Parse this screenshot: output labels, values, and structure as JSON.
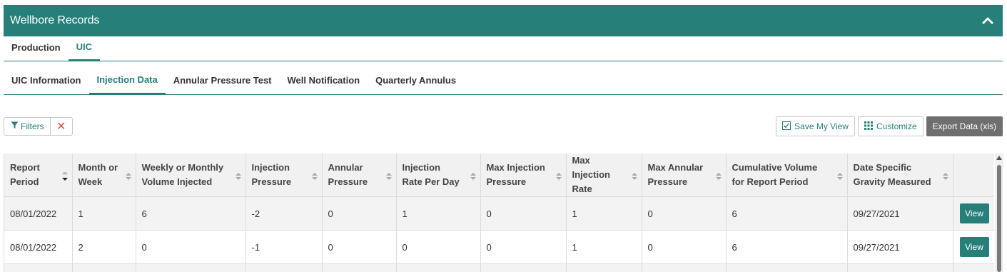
{
  "header": {
    "title": "Wellbore Records",
    "collapse_icon": "chevron-up-icon"
  },
  "tabs_primary": [
    {
      "label": "Production",
      "active": false
    },
    {
      "label": "UIC",
      "active": true
    }
  ],
  "tabs_secondary": [
    {
      "label": "UIC Information",
      "active": false
    },
    {
      "label": "Injection Data",
      "active": true
    },
    {
      "label": "Annular Pressure Test",
      "active": false
    },
    {
      "label": "Well Notification",
      "active": false
    },
    {
      "label": "Quarterly Annulus",
      "active": false
    }
  ],
  "toolbar": {
    "filters_label": "Filters",
    "clear_label": "✕",
    "save_view_label": "Save My View",
    "customize_label": "Customize",
    "export_label": "Export Data (xls)"
  },
  "table": {
    "columns": [
      {
        "label": "Report Period",
        "sorted": "desc"
      },
      {
        "label": "Month or Week"
      },
      {
        "label": "Weekly or Monthly Volume Injected"
      },
      {
        "label": "Injection Pressure"
      },
      {
        "label": "Annular Pressure"
      },
      {
        "label": "Injection Rate Per Day"
      },
      {
        "label": "Max Injection Pressure"
      },
      {
        "label": "Max Injection Rate"
      },
      {
        "label": "Max Annular Pressure"
      },
      {
        "label": "Cumulative Volume for Report Period"
      },
      {
        "label": "Date Specific Gravity Measured"
      }
    ],
    "rows": [
      [
        "08/01/2022",
        "1",
        "6",
        "-2",
        "0",
        "1",
        "0",
        "1",
        "0",
        "6",
        "09/27/2021"
      ],
      [
        "08/01/2022",
        "2",
        "0",
        "-1",
        "0",
        "0",
        "0",
        "1",
        "0",
        "6",
        "09/27/2021"
      ]
    ],
    "row_action_label": "View"
  },
  "colors": {
    "accent": "#277f7a",
    "export_bg": "#6f6f6f",
    "clear_red": "#d9534f"
  }
}
